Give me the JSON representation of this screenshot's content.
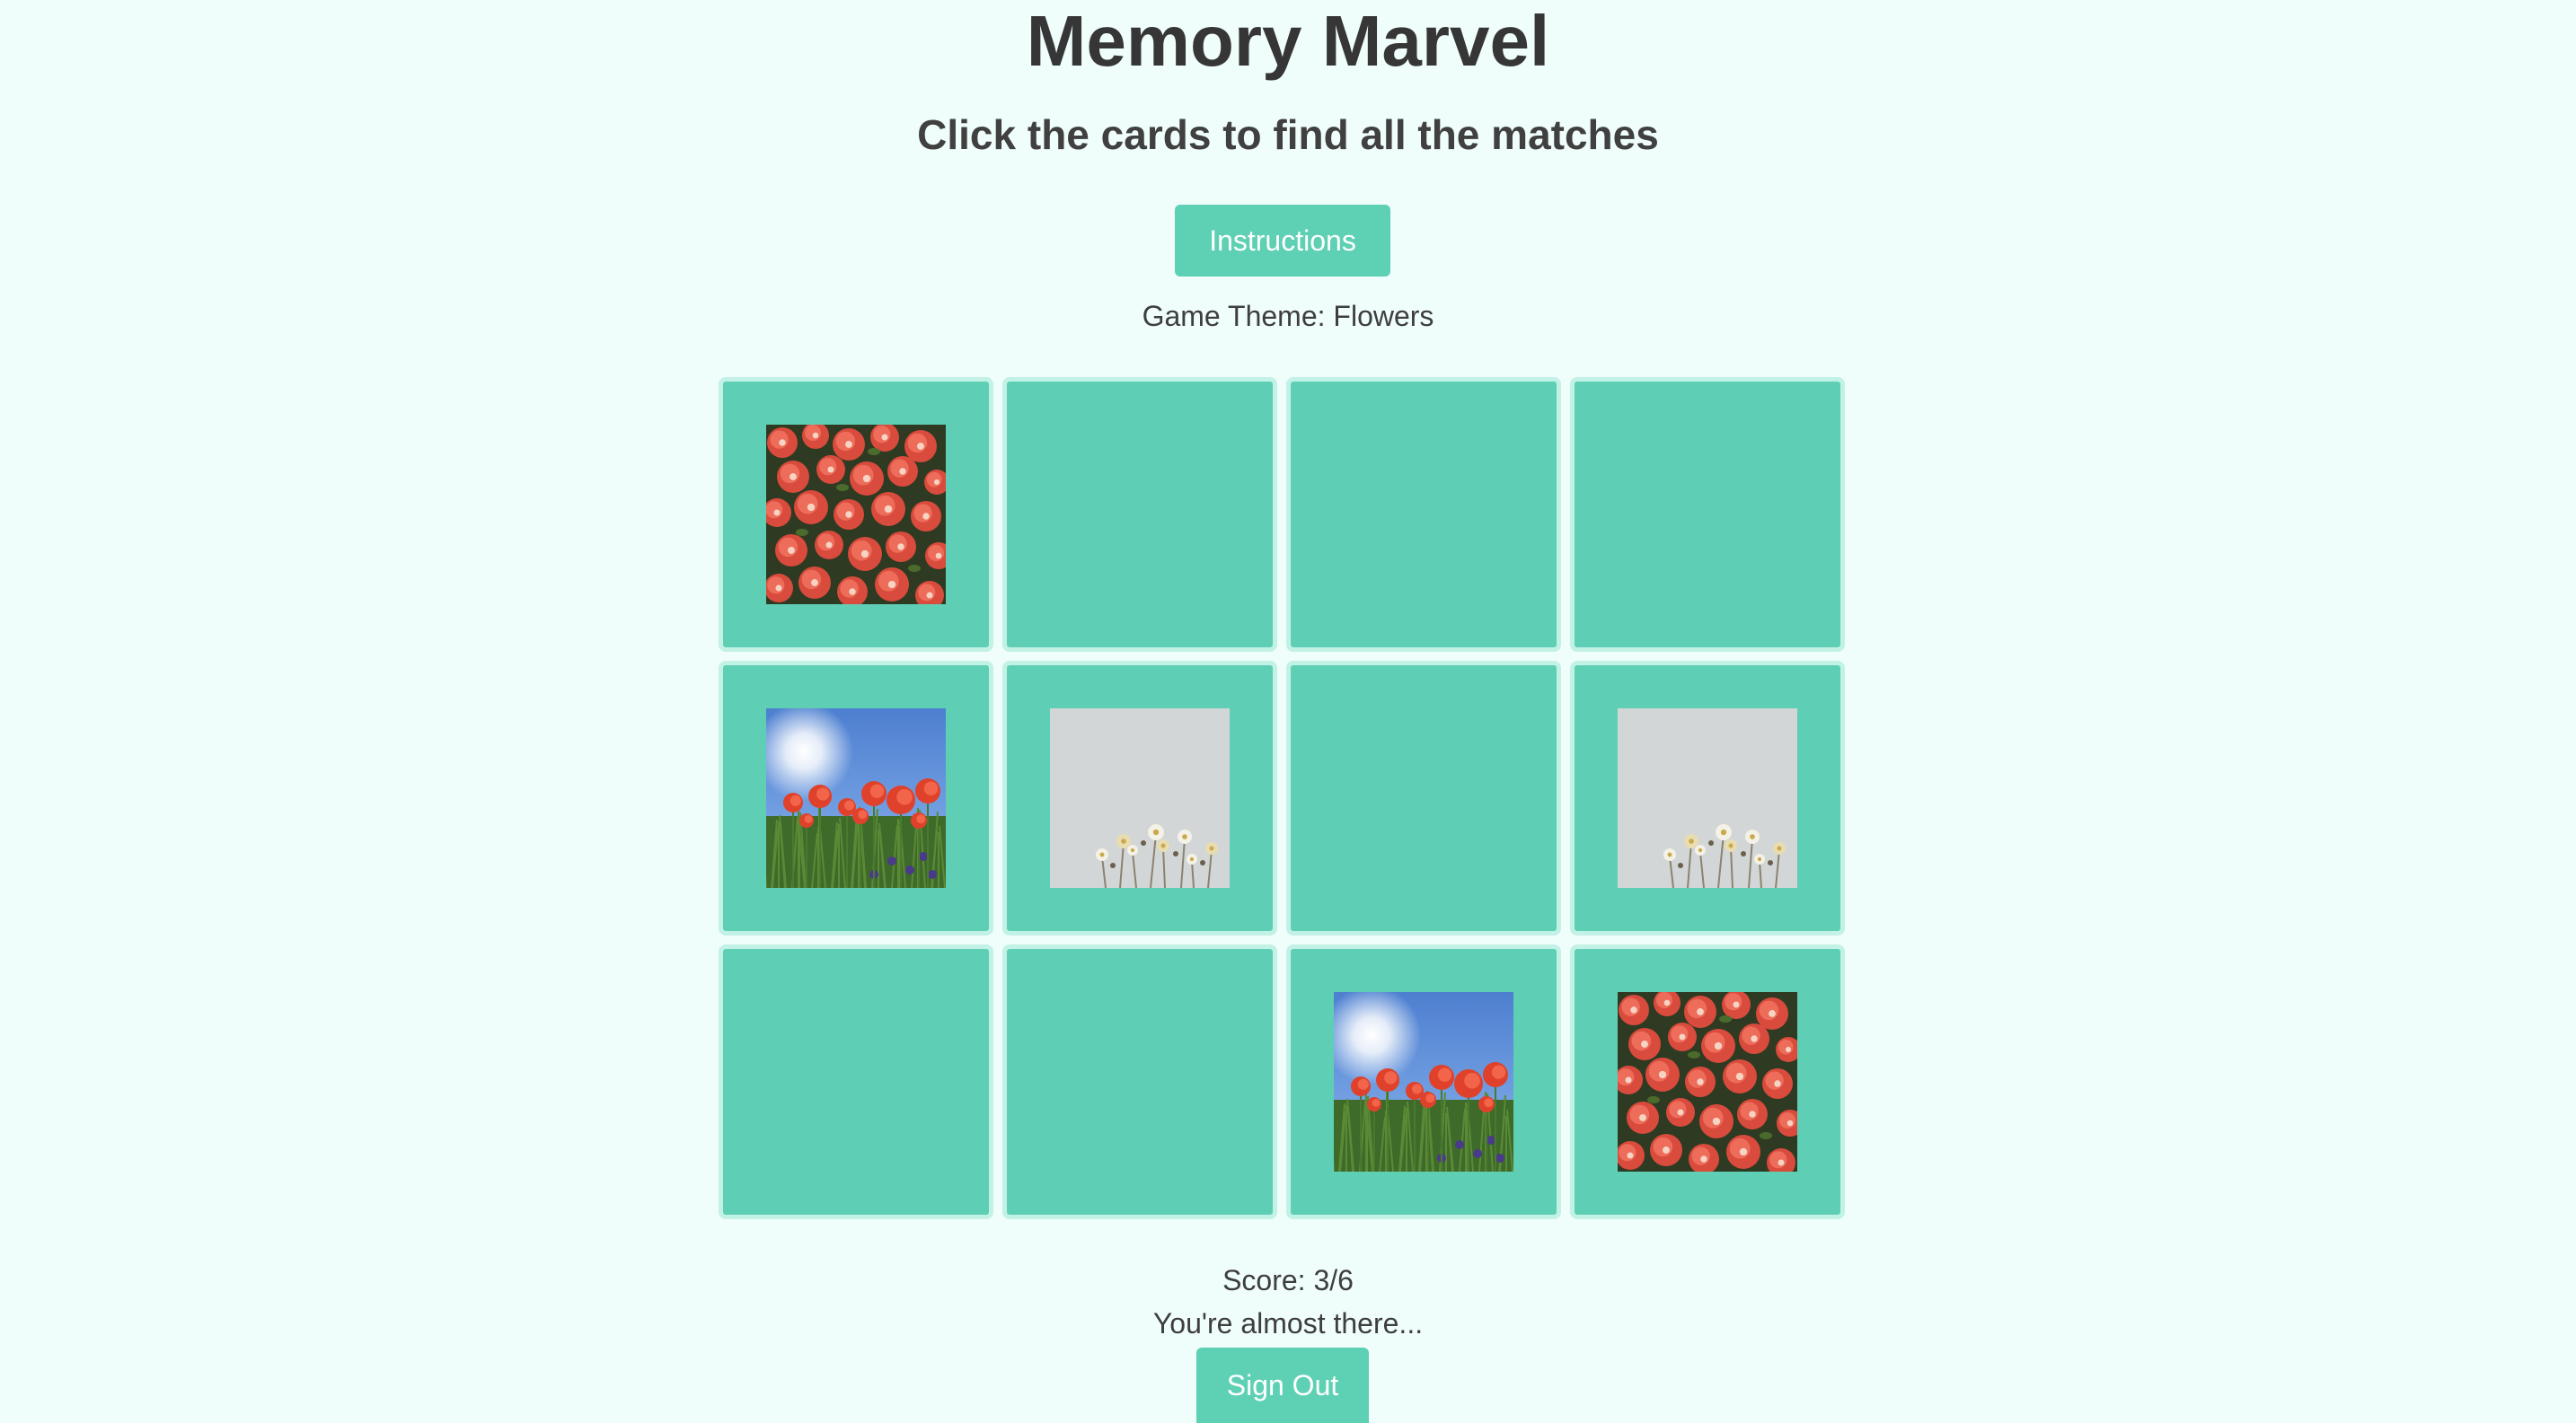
{
  "header": {
    "title": "Memory Marvel",
    "subtitle": "Click the cards to find all the matches",
    "instructions_label": "Instructions"
  },
  "theme": {
    "text": "Game Theme: Flowers"
  },
  "board": {
    "columns": 4,
    "rows": 3,
    "cards": [
      {
        "state": "face-up",
        "image": "red-begonias"
      },
      {
        "state": "face-down",
        "image": null
      },
      {
        "state": "face-down",
        "image": null
      },
      {
        "state": "face-down",
        "image": null
      },
      {
        "state": "face-up",
        "image": "red-poppies-sky"
      },
      {
        "state": "face-up",
        "image": "white-wildflowers"
      },
      {
        "state": "face-down",
        "image": null
      },
      {
        "state": "face-up",
        "image": "white-wildflowers"
      },
      {
        "state": "face-down",
        "image": null
      },
      {
        "state": "face-down",
        "image": null
      },
      {
        "state": "face-up",
        "image": "red-poppies-sky"
      },
      {
        "state": "face-up",
        "image": "red-begonias"
      }
    ]
  },
  "footer": {
    "score": "Score: 3/6",
    "status": "You're almost there...",
    "sign_out_label": "Sign Out"
  },
  "colors": {
    "background": "#effdfb",
    "accent": "#5ecfb4",
    "card_border": "#c2f1e5",
    "text": "#3a3a3a"
  }
}
